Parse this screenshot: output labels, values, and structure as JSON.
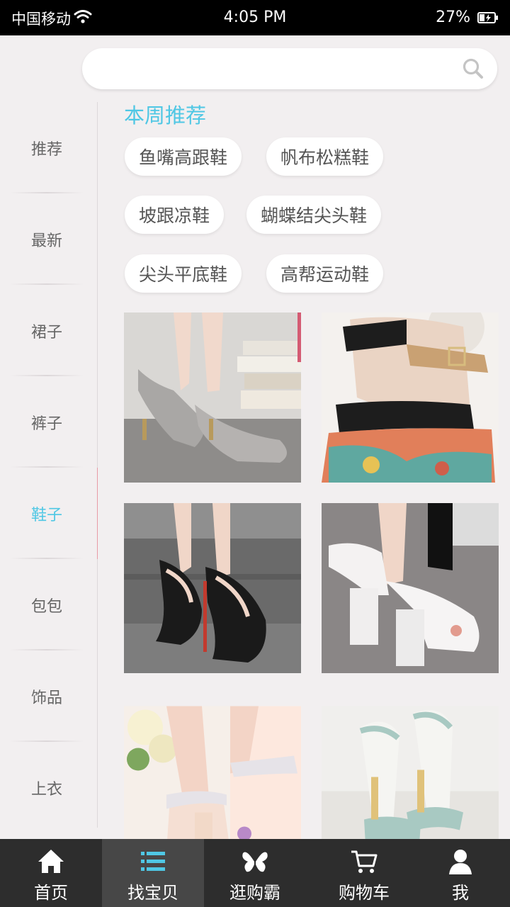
{
  "status_bar": {
    "carrier": "中国移动",
    "time": "4:05 PM",
    "battery": "27%"
  },
  "search": {
    "placeholder": ""
  },
  "sidebar": {
    "items": [
      {
        "label": "推荐"
      },
      {
        "label": "最新"
      },
      {
        "label": "裙子"
      },
      {
        "label": "裤子"
      },
      {
        "label": "鞋子"
      },
      {
        "label": "包包"
      },
      {
        "label": "饰品"
      },
      {
        "label": "上衣"
      }
    ],
    "active_index": 4
  },
  "section": {
    "title": "本周推荐"
  },
  "tags": [
    "鱼嘴高跟鞋",
    "帆布松糕鞋",
    "坡跟凉鞋",
    "蝴蝶结尖头鞋",
    "尖头平底鞋",
    "高帮运动鞋"
  ],
  "products": [
    {
      "icon": "silver-pointed-heels-photo"
    },
    {
      "icon": "black-platform-sandal-photo"
    },
    {
      "icon": "black-peep-toe-heels-photo"
    },
    {
      "icon": "white-block-heel-sandals-photo"
    },
    {
      "icon": "pink-jeweled-heel-sandals-photo"
    },
    {
      "icon": "mint-ankle-strap-sandals-photo"
    }
  ],
  "tabbar": {
    "tabs": [
      {
        "label": "首页",
        "icon": "home-icon"
      },
      {
        "label": "找宝贝",
        "icon": "list-icon"
      },
      {
        "label": "逛购霸",
        "icon": "butterfly-icon"
      },
      {
        "label": "购物车",
        "icon": "cart-icon"
      },
      {
        "label": "我",
        "icon": "user-icon"
      }
    ],
    "active_index": 1
  },
  "colors": {
    "accent": "#4fc7e4",
    "background": "#f2eff0",
    "tabbar": "#2d2d2d",
    "tabbar_active": "#474747"
  }
}
